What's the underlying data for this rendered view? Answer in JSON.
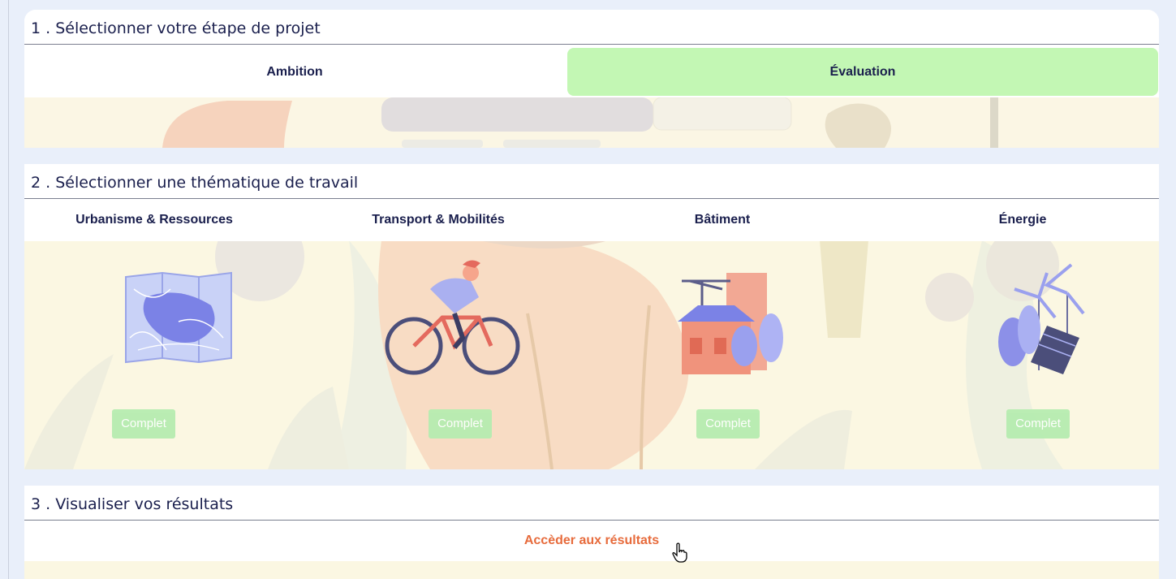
{
  "step1": {
    "title": "1 . Sélectionner votre étape de projet",
    "stages": [
      "Ambition",
      "Évaluation"
    ],
    "selected": "Évaluation"
  },
  "step2": {
    "title": "2 . Sélectionner une thématique de travail",
    "themes": [
      {
        "label": "Urbanisme & Ressources",
        "icon": "map-icon",
        "status": "Complet"
      },
      {
        "label": "Transport & Mobilités",
        "icon": "cyclist-icon",
        "status": "Complet"
      },
      {
        "label": "Bâtiment",
        "icon": "building-icon",
        "status": "Complet"
      },
      {
        "label": "Énergie",
        "icon": "wind-solar-icon",
        "status": "Complet"
      }
    ]
  },
  "step3": {
    "title": "3 . Visualiser vos résultats",
    "link": "Accèder aux résultats"
  },
  "colors": {
    "navy": "#1a1f4d",
    "selected_tab": "#c3f7b4",
    "accent_orange": "#e76b3c",
    "badge_green": "#b6ecb0",
    "page_bg": "#e9effa"
  }
}
